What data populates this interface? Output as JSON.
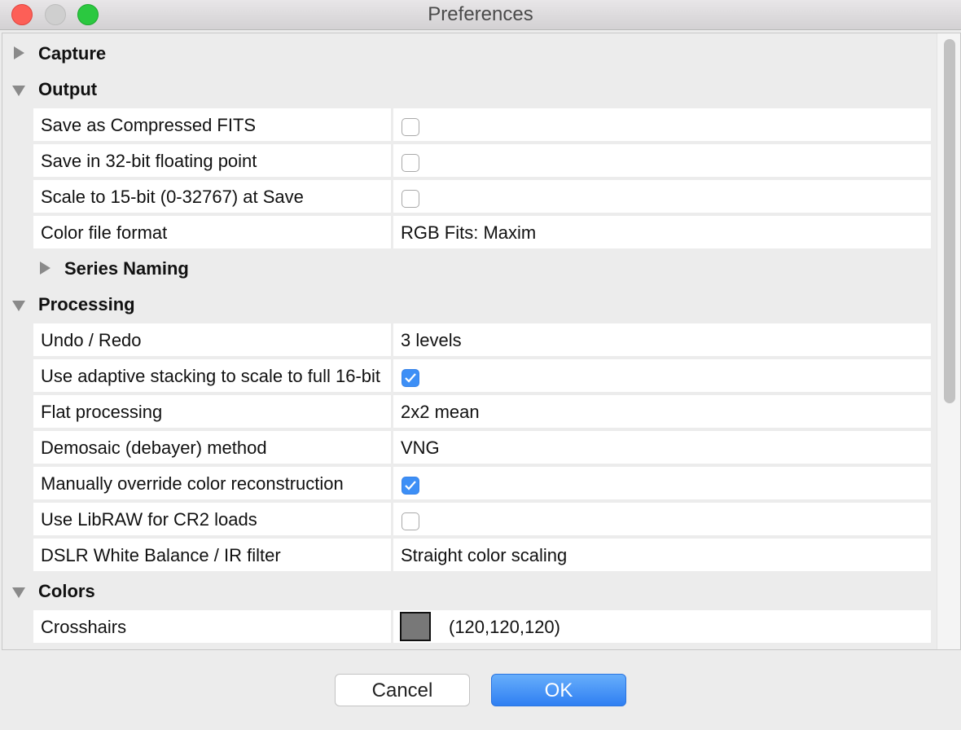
{
  "window": {
    "title": "Preferences"
  },
  "groups": {
    "capture": "Capture",
    "output": "Output",
    "series_naming": "Series Naming",
    "processing": "Processing",
    "colors": "Colors"
  },
  "output": {
    "compressed_fits_label": "Save as Compressed FITS",
    "compressed_fits_checked": false,
    "float32_label": "Save in 32-bit floating point",
    "float32_checked": false,
    "scale15_label": "Scale to 15-bit (0-32767) at Save",
    "scale15_checked": false,
    "color_format_label": "Color file format",
    "color_format_value": "RGB Fits: Maxim"
  },
  "processing": {
    "undo_label": "Undo / Redo",
    "undo_value": "3 levels",
    "adaptive_label": "Use adaptive stacking to scale to full 16-bit",
    "adaptive_checked": true,
    "flat_label": "Flat processing",
    "flat_value": "2x2 mean",
    "demosaic_label": "Demosaic (debayer) method",
    "demosaic_value": "VNG",
    "override_label": "Manually override color reconstruction",
    "override_checked": true,
    "libraw_label": "Use LibRAW for CR2 loads",
    "libraw_checked": false,
    "wb_label": "DSLR White Balance / IR filter",
    "wb_value": "Straight color scaling"
  },
  "colors": {
    "crosshairs_label": "Crosshairs",
    "crosshairs_swatch": "#787878",
    "crosshairs_value": "(120,120,120)"
  },
  "buttons": {
    "cancel": "Cancel",
    "ok": "OK"
  },
  "theme": {
    "accent": "#3d8ff6",
    "close": "#fd5f57",
    "maximize": "#2bc840"
  }
}
